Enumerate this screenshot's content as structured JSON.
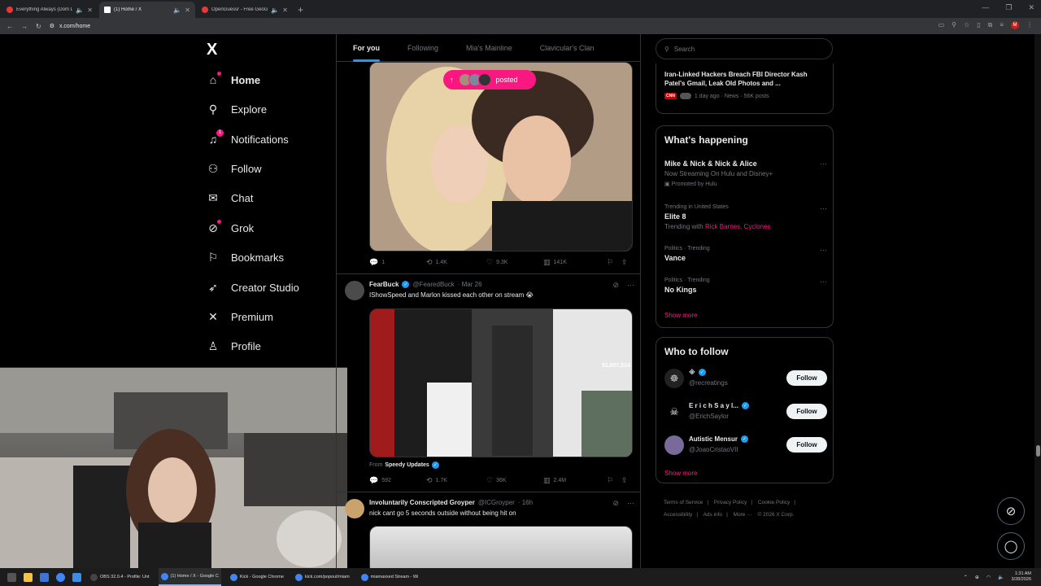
{
  "browser": {
    "tabs": [
      {
        "title": "Everything Always (Dom Di",
        "color": "#e53935"
      },
      {
        "title": "(1) Home / X",
        "color": "#ffffff"
      },
      {
        "title": "OpenGuessr - Free GeoGue",
        "color": "#e53935"
      }
    ],
    "url": "x.com/home"
  },
  "nav": {
    "logo": "X",
    "items": [
      {
        "label": "Home",
        "icon": "home-icon",
        "glyph": "⌂"
      },
      {
        "label": "Explore",
        "icon": "search-icon",
        "glyph": "⚲"
      },
      {
        "label": "Notifications",
        "icon": "bell-icon",
        "glyph": "🔔"
      },
      {
        "label": "Follow",
        "icon": "person-plus-icon",
        "glyph": "👤"
      },
      {
        "label": "Chat",
        "icon": "mail-icon",
        "glyph": "✉"
      },
      {
        "label": "Grok",
        "icon": "grok-icon",
        "glyph": "⊘"
      },
      {
        "label": "Bookmarks",
        "icon": "bookmark-icon",
        "glyph": "🔖"
      },
      {
        "label": "Creator Studio",
        "icon": "rocket-icon",
        "glyph": "🚀"
      },
      {
        "label": "Premium",
        "icon": "x-premium-icon",
        "glyph": "X"
      },
      {
        "label": "Profile",
        "icon": "profile-icon",
        "glyph": "👤"
      }
    ],
    "notifications_badge": "1"
  },
  "timeline": {
    "tabs": [
      "For you",
      "Following",
      "Mia's Mainline",
      "Clavicular's Clan"
    ],
    "posted_pill": "posted",
    "post1": {
      "replies": "1",
      "reposts": "1.4K",
      "likes": "9.3K",
      "views": "141K"
    },
    "post2": {
      "name": "FearBuck",
      "handle": "@FearedBuck",
      "date": "· Mar 26",
      "text": "IShowSpeed and Marlon kissed each other on stream 😭",
      "media_counter": "51,607,514",
      "from_label": "From",
      "from_name": "Speedy Updates",
      "replies": "592",
      "reposts": "1.7K",
      "likes": "36K",
      "views": "2.4M"
    },
    "post3": {
      "name": "Involuntarily Conscripted Groyper",
      "handle": "@ICGroyper",
      "date": "· 16h",
      "text": "nick cant go 5 seconds outside without being hit on"
    }
  },
  "sidebar": {
    "search_placeholder": "Search",
    "news": {
      "title": "Iran-Linked Hackers Breach FBI Director Kash Patel's Gmail, Leak Old Photos and ...",
      "source": "CNN",
      "meta": "1 day ago · News · 56K posts"
    },
    "happening": {
      "title": "What's happening",
      "promo": {
        "name": "Mike & Nick & Nick & Alice",
        "sub": "Now Streaming On Hulu and Disney+",
        "promoted": "Promoted by Hulu"
      },
      "trends": [
        {
          "cap": "Trending in United States",
          "name": "Elite 8",
          "sub_prefix": "Trending with",
          "sub_links": "Rick Barnes, Cyclones"
        },
        {
          "cap": "Politics · Trending",
          "name": "Vance"
        },
        {
          "cap": "Politics · Trending",
          "name": "No Kings"
        }
      ],
      "show_more": "Show more"
    },
    "who_to_follow": {
      "title": "Who to follow",
      "accounts": [
        {
          "name": "※",
          "handle": "@recreatings",
          "button": "Follow"
        },
        {
          "name": "E r i c h S a y l...",
          "handle": "@ErichSaylor",
          "button": "Follow"
        },
        {
          "name": "Autistic Mensur",
          "handle": "@JoaoCristaoVII",
          "button": "Follow"
        }
      ],
      "show_more": "Show more"
    },
    "footer": [
      "Terms of Service",
      "|",
      "Privacy Policy",
      "|",
      "Cookie Policy",
      "|",
      "Accessibility",
      "|",
      "Ads info",
      "|",
      "More ···",
      "© 2026 X Corp."
    ]
  },
  "taskbar": {
    "apps": [
      {
        "label": "OBS 32.0.4 - Profile: Unt",
        "color": "#444"
      },
      {
        "label": "(1) Home / X - Google C",
        "color": "#4285f4"
      },
      {
        "label": "Kick - Google Chrome",
        "color": "#4285f4"
      },
      {
        "label": "kick.com/popout/miam",
        "color": "#4285f4"
      },
      {
        "label": "miamaxxed Stream - Wi",
        "color": "#4285f4"
      }
    ],
    "time": "1:31 AM",
    "date": "3/28/2026"
  }
}
